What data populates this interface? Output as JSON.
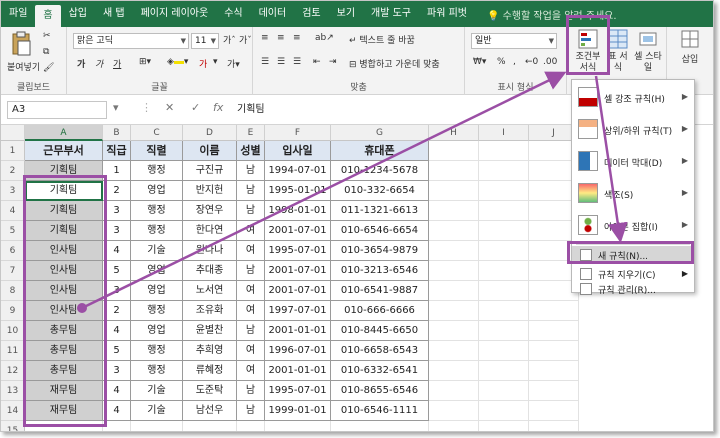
{
  "tabs": [
    "파일",
    "홈",
    "삽입",
    "새 탭",
    "페이지 레이아웃",
    "수식",
    "데이터",
    "검토",
    "보기",
    "개발 도구",
    "파워 피벗"
  ],
  "active_tab": "홈",
  "tell_me": "수행할 작업을 알려 주세요.",
  "ribbon": {
    "clipboard": {
      "paste_label": "붙여넣기",
      "group_label": "클립보드"
    },
    "font": {
      "font_name": "맑은 고딕",
      "font_size": "11",
      "bold": "가",
      "italic": "가",
      "underline": "가",
      "font_color": "가",
      "group_label": "글꼴"
    },
    "alignment": {
      "wrap_text": "텍스트 줄 바꿈",
      "merge_center": "병합하고 가운데 맞춤",
      "group_label": "맞춤"
    },
    "number": {
      "format": "일반",
      "group_label": "표시 형식",
      "percent": "%",
      "comma": ","
    },
    "styles": {
      "cond_format": "조건부 서식",
      "format_table": "표 서식",
      "cell_style": "셀 스타일"
    },
    "cells": {
      "insert": "삽입"
    }
  },
  "formula_bar": {
    "name_box": "A3",
    "fx": "fx",
    "value": "기획팀"
  },
  "columns": [
    "A",
    "B",
    "C",
    "D",
    "E",
    "F",
    "G",
    "H",
    "I",
    "J"
  ],
  "table": {
    "headers": [
      "근무부서",
      "직급",
      "직렬",
      "이름",
      "성별",
      "입사일",
      "휴대폰"
    ],
    "rows": [
      [
        "기획팀",
        "1",
        "행정",
        "구진규",
        "남",
        "1994-07-01",
        "010-1234-5678"
      ],
      [
        "기획팀",
        "2",
        "영업",
        "반지헌",
        "남",
        "1995-01-01",
        "010-332-6654"
      ],
      [
        "기획팀",
        "3",
        "행정",
        "장연우",
        "남",
        "1998-01-01",
        "011-1321-6613"
      ],
      [
        "기획팀",
        "3",
        "행정",
        "한다연",
        "여",
        "2001-07-01",
        "010-6546-6654"
      ],
      [
        "인사팀",
        "4",
        "기술",
        "원나나",
        "여",
        "1995-07-01",
        "010-3654-9879"
      ],
      [
        "인사팀",
        "5",
        "영업",
        "추대종",
        "남",
        "2001-07-01",
        "010-3213-6546"
      ],
      [
        "인사팀",
        "3",
        "영업",
        "노서연",
        "여",
        "2001-07-01",
        "010-6541-9887"
      ],
      [
        "인사팀",
        "2",
        "행정",
        "조유화",
        "여",
        "1997-07-01",
        "010-666-6666"
      ],
      [
        "총무팀",
        "4",
        "영업",
        "윤별찬",
        "남",
        "2001-01-01",
        "010-8445-6650"
      ],
      [
        "총무팀",
        "5",
        "행정",
        "추희영",
        "여",
        "1996-07-01",
        "010-6658-6543"
      ],
      [
        "총무팀",
        "3",
        "행정",
        "류혜정",
        "여",
        "2001-01-01",
        "010-6332-6541"
      ],
      [
        "재무팀",
        "4",
        "기술",
        "도준탁",
        "남",
        "1995-07-01",
        "010-8655-6546"
      ],
      [
        "재무팀",
        "4",
        "기술",
        "남선우",
        "남",
        "1999-01-01",
        "010-6546-1111"
      ]
    ],
    "row_numbers": [
      "1",
      "2",
      "3",
      "4",
      "5",
      "6",
      "7",
      "8",
      "9",
      "10",
      "11",
      "12",
      "13",
      "14",
      "15"
    ]
  },
  "cond_menu": {
    "items": [
      {
        "label": "셀 강조 규칙(H)",
        "icon": "highlight-cells-icon"
      },
      {
        "label": "상위/하위 규칙(T)",
        "icon": "top-bottom-icon"
      },
      {
        "label": "데이터 막대(D)",
        "icon": "data-bars-icon"
      },
      {
        "label": "색조(S)",
        "icon": "color-scales-icon"
      },
      {
        "label": "아이콘 집합(I)",
        "icon": "icon-sets-icon"
      }
    ],
    "new_rule": "새 규칙(N)...",
    "clear_rules": "규칙 지우기(C)",
    "manage_rules": "규칙 관리(R)..."
  },
  "colors": {
    "excel_green": "#217346",
    "highlight": "#9b4fa5",
    "header_fill": "#dde6f2",
    "cell_fill": "#d0d0d0"
  }
}
